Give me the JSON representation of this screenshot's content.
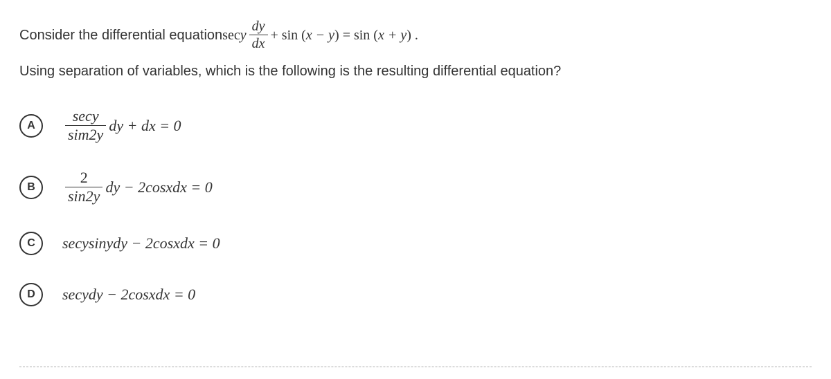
{
  "question": {
    "prefix": "Consider the differential equation ",
    "eq_lead": "sec",
    "eq_y": "y",
    "frac_num": "dy",
    "frac_den": "dx",
    "plus": " + sin (",
    "xminusy": "x − y",
    "close1": ") = sin (",
    "xplusy": "x + y",
    "close2": ") .",
    "line2": "Using separation of variables, which is the following is the resulting differential equation?"
  },
  "options": {
    "a": {
      "letter": "A",
      "frac_num": "secy",
      "frac_den": "sim2y",
      "rest": "dy + dx = 0"
    },
    "b": {
      "letter": "B",
      "frac_num": "2",
      "frac_den": "sin2y",
      "rest": "dy − 2cosxdx = 0"
    },
    "c": {
      "letter": "C",
      "text": "secysinydy − 2cosxdx = 0"
    },
    "d": {
      "letter": "D",
      "text": "secydy − 2cosxdx = 0"
    }
  }
}
